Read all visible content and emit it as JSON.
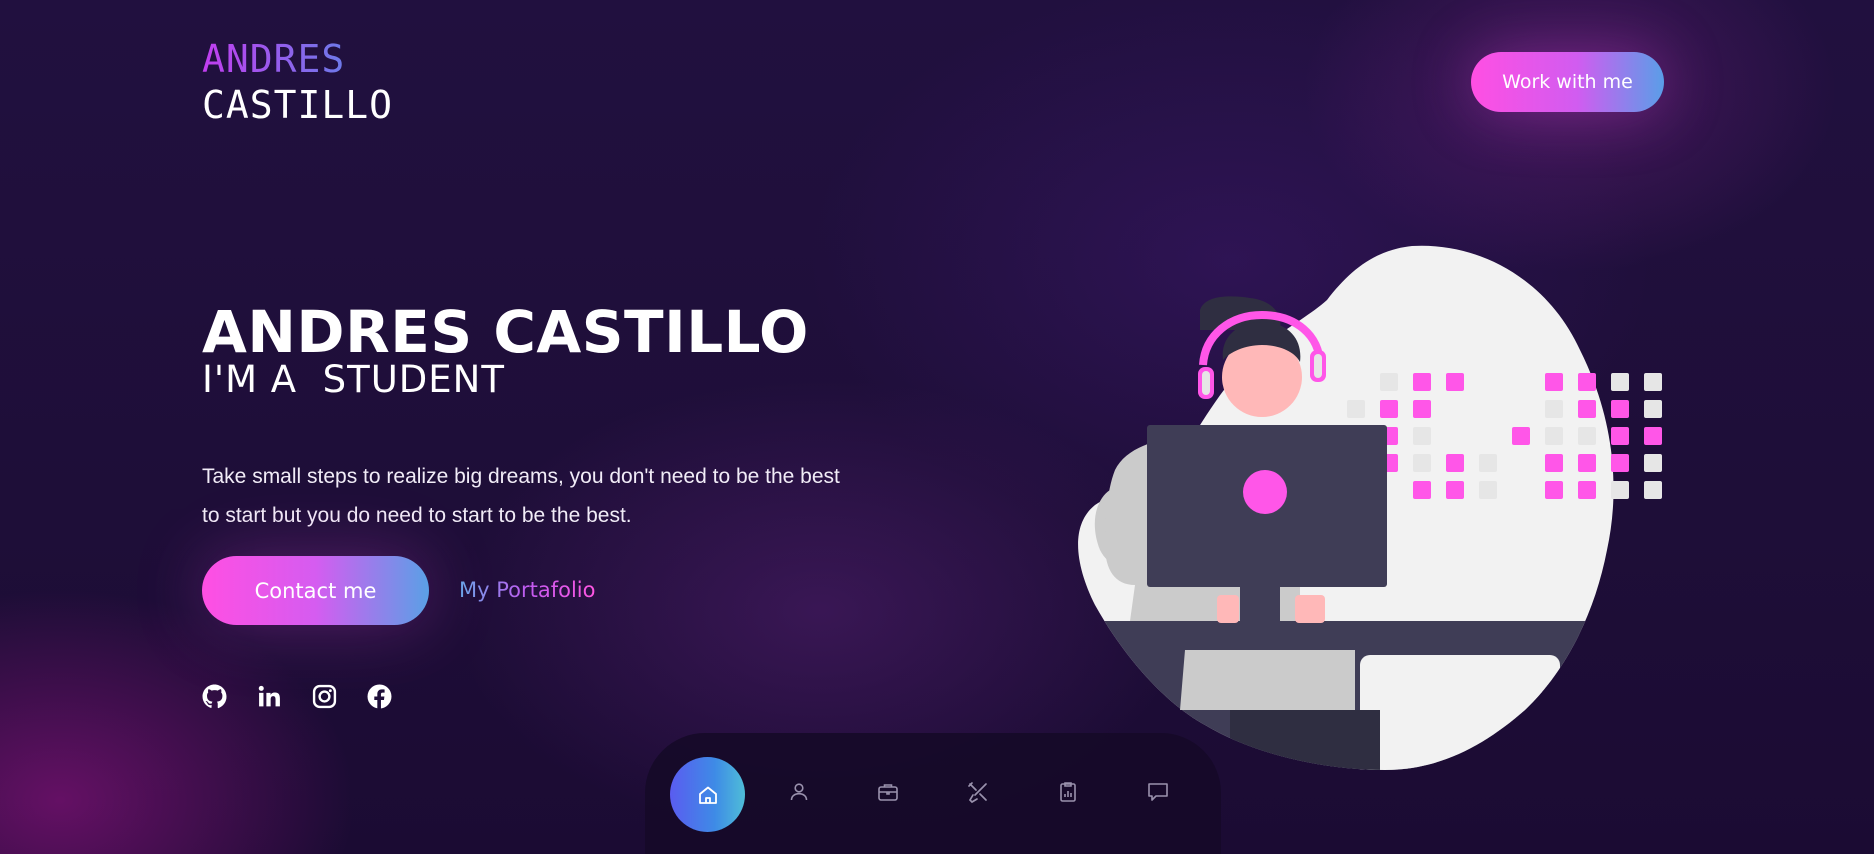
{
  "logo": {
    "line1": "ANDRES",
    "line2": "CASTILLO"
  },
  "header": {
    "cta_label": "Work with me"
  },
  "hero": {
    "name": "ANDRES CASTILLO",
    "role_prefix": "I'M A ",
    "role": " STUDENT",
    "quote": "Take small steps to realize big dreams, you don't need to be the best to start but you do need to start to be the best.",
    "contact_label": "Contact me",
    "portfolio_label": "My Portafolio"
  },
  "socials": [
    {
      "icon": "github-icon"
    },
    {
      "icon": "linkedin-icon"
    },
    {
      "icon": "instagram-icon"
    },
    {
      "icon": "facebook-icon"
    }
  ],
  "nav": {
    "items": [
      {
        "icon": "home-icon",
        "active": true
      },
      {
        "icon": "user-icon"
      },
      {
        "icon": "briefcase-icon"
      },
      {
        "icon": "tools-icon"
      },
      {
        "icon": "clipboard-chart-icon"
      },
      {
        "icon": "chat-icon"
      }
    ]
  },
  "colors": {
    "background": "#1f0f3a",
    "accent_pink": "#ff4fe3",
    "accent_blue": "#5a9ee8",
    "illustration_pink": "#ff56e8"
  }
}
